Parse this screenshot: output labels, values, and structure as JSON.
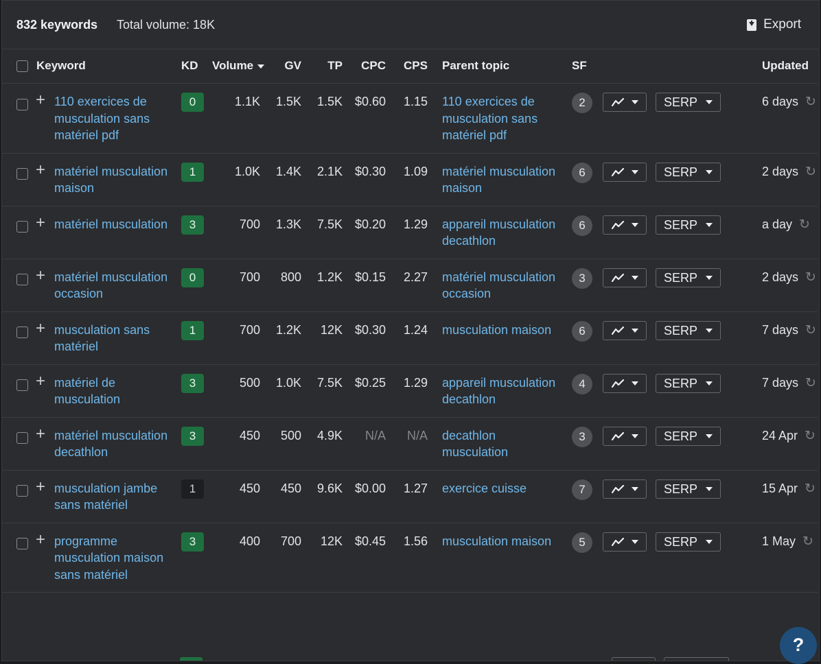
{
  "header": {
    "keyword_count": "832 keywords",
    "total_volume": "Total volume: 18K",
    "export_label": "Export"
  },
  "columns": {
    "keyword": "Keyword",
    "kd": "KD",
    "volume": "Volume",
    "gv": "GV",
    "tp": "TP",
    "cpc": "CPC",
    "cps": "CPS",
    "parent_topic": "Parent topic",
    "sf": "SF",
    "updated": "Updated"
  },
  "serp_label": "SERP",
  "colors": {
    "kd_low": "#1f7040",
    "kd_zero_dark": "#1d1e20",
    "link": "#6fb7ea",
    "help_button": "#1f4e7a"
  },
  "rows": [
    {
      "keyword": "110 exercices de musculation sans matériel pdf",
      "kd": "0",
      "volume": "1.1K",
      "gv": "1.5K",
      "tp": "1.5K",
      "cpc": "$0.60",
      "cps": "1.15",
      "parent": "110 exercices de musculation sans matériel pdf",
      "sf": "2",
      "updated": "6 days"
    },
    {
      "keyword": "matériel musculation maison",
      "kd": "1",
      "volume": "1.0K",
      "gv": "1.4K",
      "tp": "2.1K",
      "cpc": "$0.30",
      "cps": "1.09",
      "parent": "matériel musculation maison",
      "sf": "6",
      "updated": "2 days"
    },
    {
      "keyword": "matériel musculation",
      "kd": "3",
      "volume": "700",
      "gv": "1.3K",
      "tp": "7.5K",
      "cpc": "$0.20",
      "cps": "1.29",
      "parent": "appareil musculation decathlon",
      "sf": "6",
      "updated": "a day"
    },
    {
      "keyword": "matériel musculation occasion",
      "kd": "0",
      "volume": "700",
      "gv": "800",
      "tp": "1.2K",
      "cpc": "$0.15",
      "cps": "2.27",
      "parent": "matériel musculation occasion",
      "sf": "3",
      "updated": "2 days"
    },
    {
      "keyword": "musculation sans matériel",
      "kd": "1",
      "volume": "700",
      "gv": "1.2K",
      "tp": "12K",
      "cpc": "$0.30",
      "cps": "1.24",
      "parent": "musculation maison",
      "sf": "6",
      "updated": "7 days"
    },
    {
      "keyword": "matériel de musculation",
      "kd": "3",
      "volume": "500",
      "gv": "1.0K",
      "tp": "7.5K",
      "cpc": "$0.25",
      "cps": "1.29",
      "parent": "appareil musculation decathlon",
      "sf": "4",
      "updated": "7 days"
    },
    {
      "keyword": "matériel musculation decathlon",
      "kd": "3",
      "volume": "450",
      "gv": "500",
      "tp": "4.9K",
      "cpc": "N/A",
      "cps": "N/A",
      "parent": "decathlon musculation",
      "sf": "3",
      "updated": "24 Apr"
    },
    {
      "keyword": "musculation jambe sans matériel",
      "kd": "1",
      "volume": "450",
      "gv": "450",
      "tp": "9.6K",
      "cpc": "$0.00",
      "cps": "1.27",
      "parent": "exercice cuisse",
      "sf": "7",
      "updated": "15 Apr",
      "kd_dark": true
    },
    {
      "keyword": "programme musculation maison sans matériel",
      "kd": "3",
      "volume": "400",
      "gv": "700",
      "tp": "12K",
      "cpc": "$0.45",
      "cps": "1.56",
      "parent": "musculation maison",
      "sf": "5",
      "updated": "1 May"
    }
  ],
  "help_label": "?"
}
